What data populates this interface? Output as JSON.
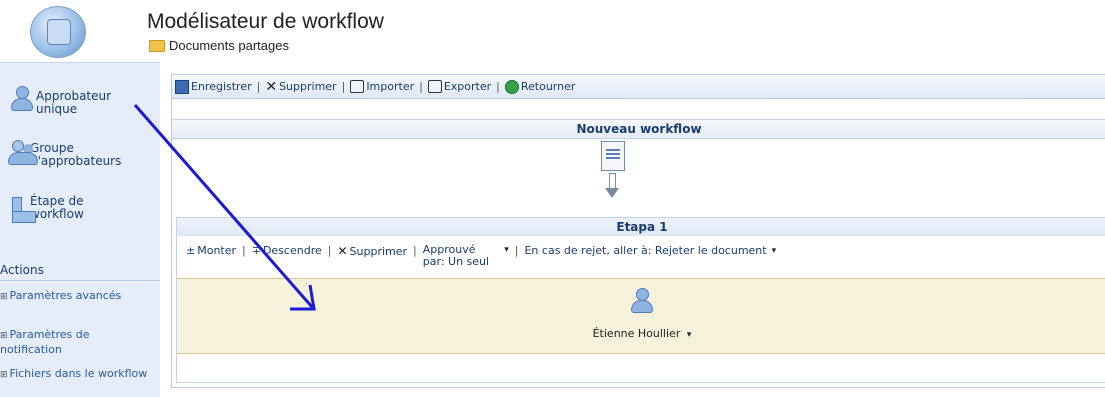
{
  "header": {
    "title": "Modélisateur de workflow",
    "breadcrumb": "Documents partages"
  },
  "sidebar": {
    "tools": [
      {
        "label": "Approbateur unique",
        "icon": "person-icon"
      },
      {
        "label": "Groupe d'approbateurs",
        "icon": "group-icon"
      },
      {
        "label": "Étape de workflow",
        "icon": "step-icon"
      }
    ],
    "actions_heading": "Actions",
    "actions": [
      {
        "label": "Paramètres avancés"
      },
      {
        "label": "Paramètres de notification"
      },
      {
        "label": "Fichiers dans le workflow"
      }
    ]
  },
  "toolbar": {
    "save": "Enregistrer",
    "delete": "Supprimer",
    "import": "Importer",
    "export": "Exporter",
    "return": "Retourner"
  },
  "workflow": {
    "title": "Nouveau workflow",
    "step": {
      "title": "Etapa 1",
      "move_up": "Monter",
      "move_down": "Descendre",
      "delete": "Supprimer",
      "approved_by": "Approuvé par: Un seul",
      "on_reject": "En cas de rejet, aller à: Rejeter le document",
      "approver_name": "Étienne Houllier"
    }
  },
  "colors": {
    "sidebar_bg": "#e4edf9",
    "accent": "#1a3d6d",
    "drag_arrow": "#1a1adb",
    "approver_bg": "#f6f1da"
  }
}
